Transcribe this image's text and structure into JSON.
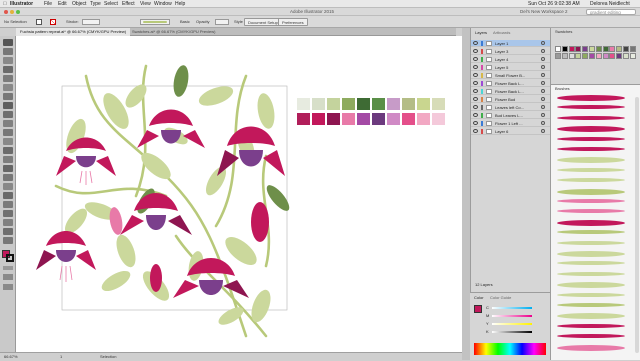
{
  "menubar": {
    "apple": "",
    "items": [
      "Illustrator",
      "File",
      "Edit",
      "Object",
      "Type",
      "Select",
      "Effect",
      "View",
      "Window",
      "Help"
    ],
    "clock": "Sun Oct 26  9:02:38 AM",
    "user": "Delorea Neidlecht"
  },
  "titlebar": {
    "title": "Adobe Illustrator 2015",
    "workspace": "Del's New Workspace 2",
    "search_placeholder": "gradient editing"
  },
  "controlbar": {
    "selection_label": "No Selection",
    "stroke_label": "Stroke:",
    "basic_label": "Basic",
    "opacity_label": "Opacity",
    "style_label": "Style",
    "doc_setup": "Document Setup",
    "preferences": "Preferences"
  },
  "tabs": [
    {
      "label": "Fuchsia pattern repeat.ai* @ 66.67% (CMYK/GPU Preview)",
      "active": true
    },
    {
      "label": "Swatches.ai* @ 66.67% (CMYK/GPU Preview)",
      "active": false
    }
  ],
  "statusbar": {
    "zoom": "66.67%",
    "artboard": "1",
    "status": "Selection"
  },
  "layers_panel": {
    "tabs": [
      "Layers",
      "Artboards"
    ],
    "rows": [
      {
        "name": "Layer 1",
        "color": "#3a7bd5",
        "selected": true
      },
      {
        "name": "Layer 3",
        "color": "#d64a4a",
        "selected": false
      },
      {
        "name": "Layer 4",
        "color": "#3fae4a",
        "selected": false
      },
      {
        "name": "Layer 5",
        "color": "#d64aa8",
        "selected": false
      },
      {
        "name": "Small Flower B...",
        "color": "#d6b84a",
        "selected": false
      },
      {
        "name": "Flower Back L...",
        "color": "#9c4ad6",
        "selected": false
      },
      {
        "name": "Flower Back L...",
        "color": "#4ad6d6",
        "selected": false
      },
      {
        "name": "Flower Bud",
        "color": "#d6844a",
        "selected": false
      },
      {
        "name": "Leaves left Co...",
        "color": "#6a6a6a",
        "selected": false
      },
      {
        "name": "Bud Leaves L...",
        "color": "#3fae4a",
        "selected": false
      },
      {
        "name": "Flower 1 Left ...",
        "color": "#3a7bd5",
        "selected": false
      },
      {
        "name": "Layer 6",
        "color": "#d64a4a",
        "selected": false
      }
    ],
    "footer": "12 Layers"
  },
  "color_panel": {
    "tabs": [
      "Color",
      "Color Guide"
    ],
    "channels": [
      "C",
      "M",
      "Y",
      "K"
    ]
  },
  "swatches_panel": {
    "title": "Swatches"
  },
  "brushes_panel": {
    "title": "Brushes"
  },
  "palette": {
    "top": [
      "#e7ebe0",
      "#d7dfc9",
      "#c4d39d",
      "#8eab5f",
      "#3e6b34",
      "#5a8f47",
      "#c79bc8",
      "#b4bd86",
      "#c9d68f",
      "#d7dcb8"
    ],
    "bottom": [
      "#b11e5a",
      "#c2185b",
      "#8e1550",
      "#e87aa8",
      "#a44aa5",
      "#6c3a7e",
      "#d08ac5",
      "#e44f8a",
      "#f2a8c3",
      "#f4c9da"
    ]
  },
  "colors": {
    "magenta": "#c2185b",
    "dark_magenta": "#8e1550",
    "purple": "#7b3f8c",
    "leaf": "#cbd89c",
    "leaf_dark": "#6e8f4a",
    "stem": "#b8c97a"
  }
}
